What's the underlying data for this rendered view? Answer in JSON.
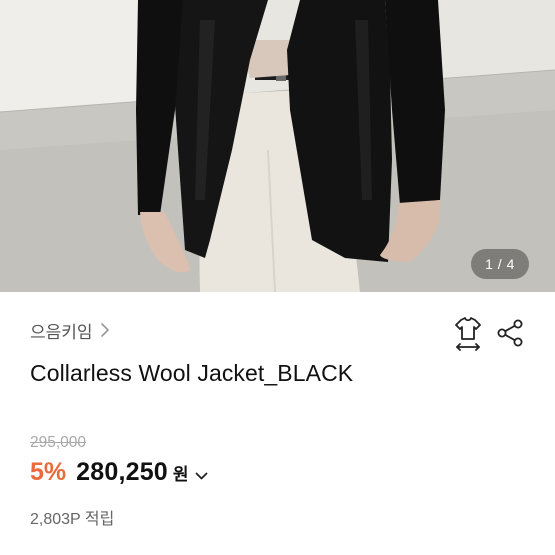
{
  "gallery": {
    "counter": "1 / 4"
  },
  "product": {
    "brand": "으음키임",
    "title": "Collarless Wool Jacket_BLACK",
    "original_price": "295,000",
    "discount_rate": "5%",
    "sale_price": "280,250",
    "currency": "원",
    "points": "2,803P 적립"
  },
  "icons": {
    "brand_link": "chevron-right-icon",
    "size_guide": "tshirt-size-icon",
    "share": "share-icon",
    "price_toggle": "chevron-down-icon"
  },
  "colors": {
    "discount": "#ea6a3c",
    "muted_text": "#a9a9a9"
  }
}
